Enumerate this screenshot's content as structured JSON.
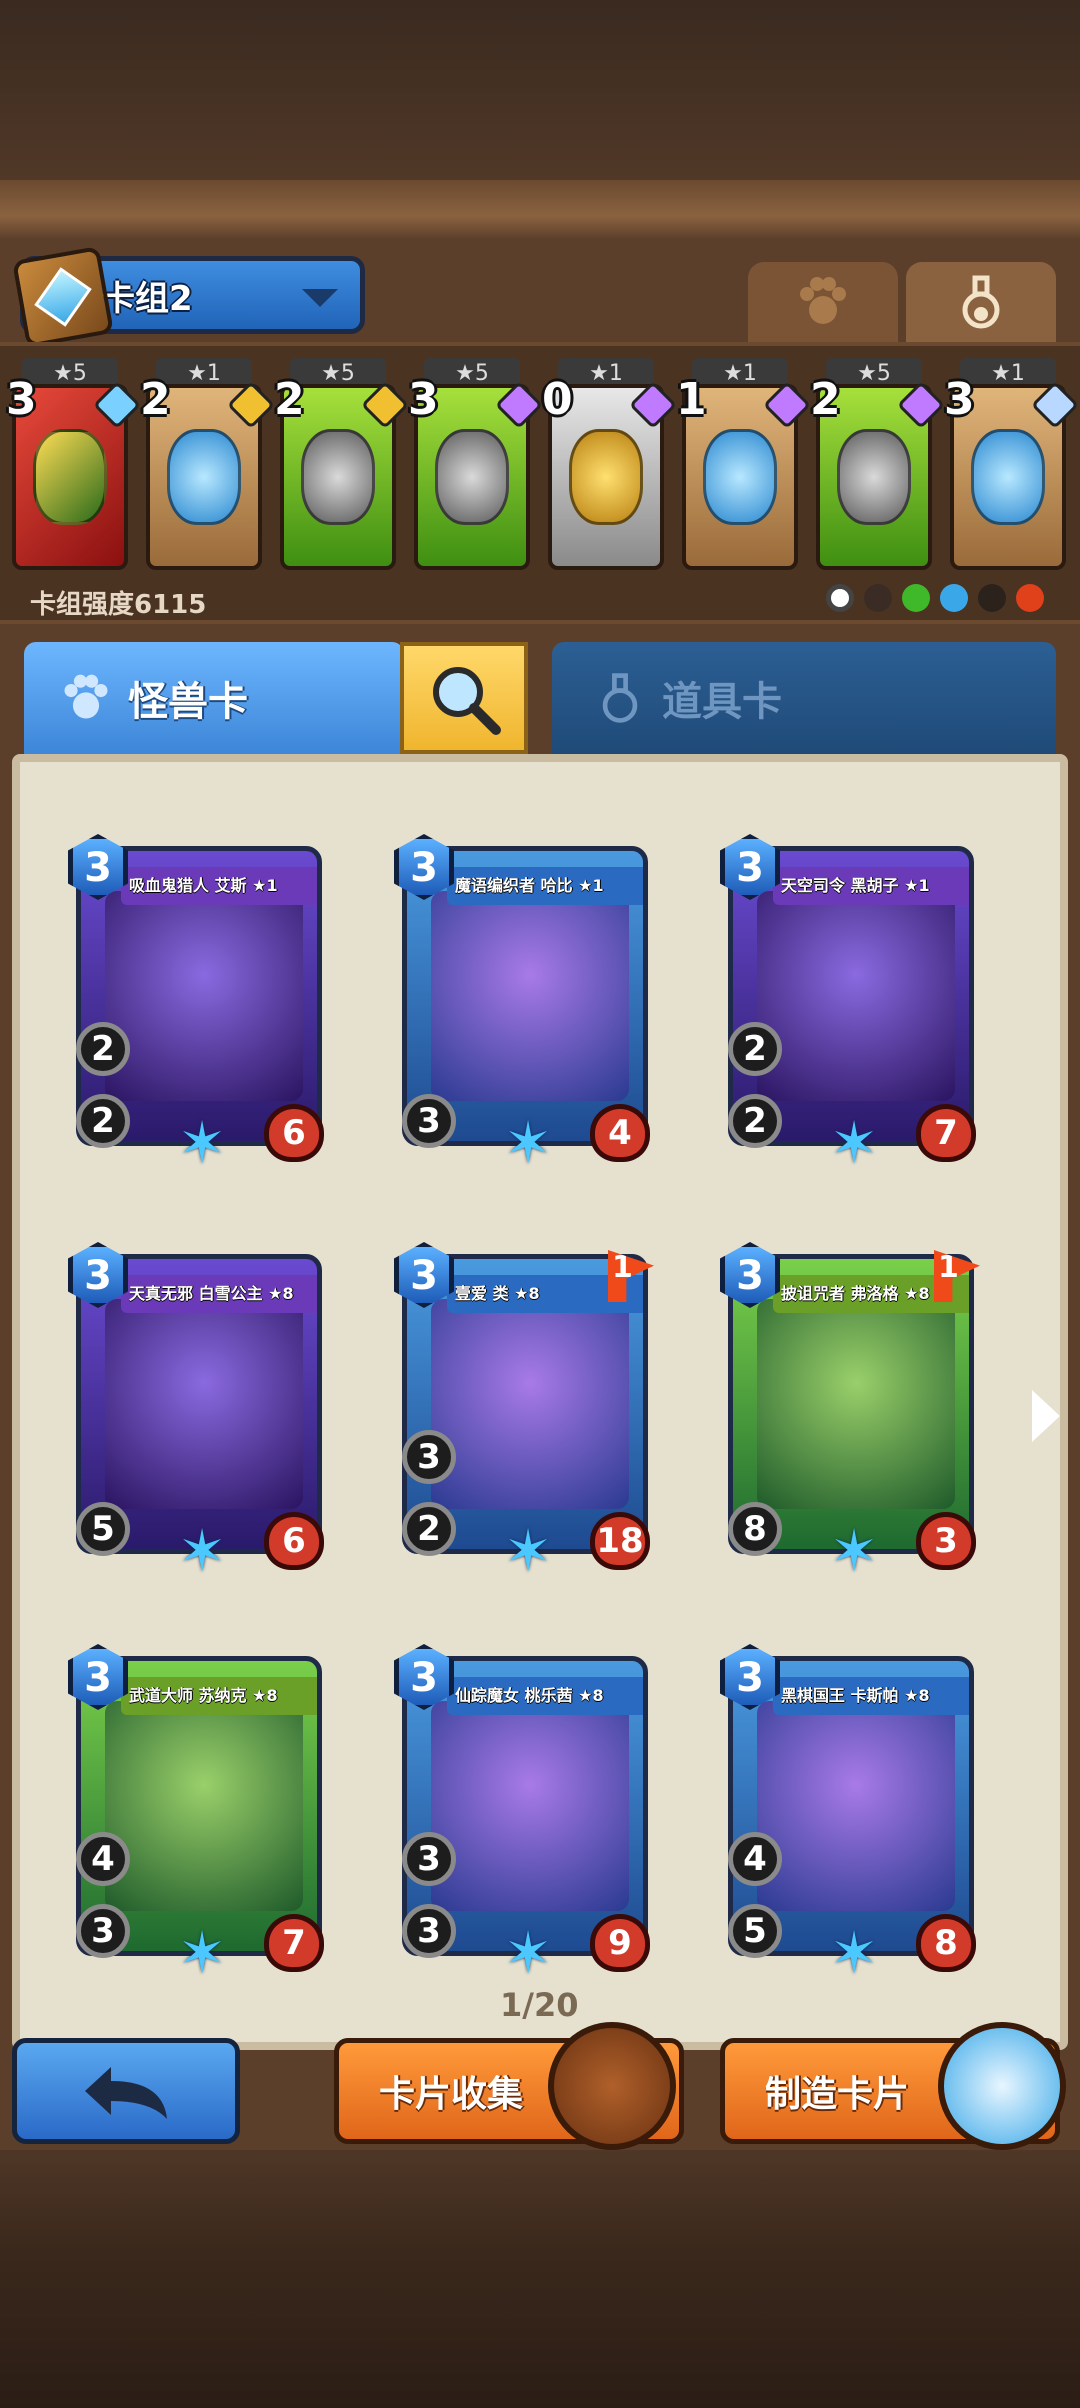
{
  "header": {
    "deck_name": "卡组2",
    "deck_power": "卡组强度6115",
    "tabs": [
      {
        "icon": "paw-icon"
      },
      {
        "icon": "potion-icon"
      }
    ]
  },
  "deck": [
    {
      "count": "3",
      "stars": "★5",
      "frame": "red",
      "gem": "#7ad0ff"
    },
    {
      "count": "2",
      "stars": "★1",
      "frame": "brown",
      "gem": "#f0c030"
    },
    {
      "count": "2",
      "stars": "★5",
      "frame": "green",
      "gem": "#f0c030"
    },
    {
      "count": "3",
      "stars": "★5",
      "frame": "green",
      "gem": "#c07aff"
    },
    {
      "count": "0",
      "stars": "★1",
      "frame": "grey",
      "gem": "#c07aff"
    },
    {
      "count": "1",
      "stars": "★1",
      "frame": "brown",
      "gem": "#c07aff"
    },
    {
      "count": "2",
      "stars": "★5",
      "frame": "green",
      "gem": "#c07aff"
    },
    {
      "count": "3",
      "stars": "★1",
      "frame": "brown",
      "gem": "#b8d8ff"
    }
  ],
  "tabs": {
    "monster": "怪兽卡",
    "item": "道具卡"
  },
  "cards": [
    {
      "name": "吸血鬼猎人 艾斯 ★1",
      "cost": "3",
      "atk_top": "2",
      "atk_bottom": "2",
      "hp": "6",
      "flag": "",
      "theme": "purple"
    },
    {
      "name": "魔语编织者 哈比 ★1",
      "cost": "3",
      "atk_top": "",
      "atk_bottom": "3",
      "hp": "4",
      "flag": "",
      "theme": "blue"
    },
    {
      "name": "天空司令 黑胡子 ★1",
      "cost": "3",
      "atk_top": "2",
      "atk_bottom": "2",
      "hp": "7",
      "flag": "",
      "theme": "purple"
    },
    {
      "name": "天真无邪 白雪公主 ★8",
      "cost": "3",
      "atk_top": "",
      "atk_bottom": "5",
      "hp": "6",
      "flag": "",
      "theme": "purple"
    },
    {
      "name": "壹爱 类 ★8",
      "cost": "3",
      "atk_top": "3",
      "atk_bottom": "2",
      "hp": "18",
      "flag": "1",
      "theme": "blue"
    },
    {
      "name": "披诅咒者 弗洛格 ★8",
      "cost": "3",
      "atk_top": "",
      "atk_bottom": "8",
      "hp": "3",
      "flag": "1",
      "theme": "green"
    },
    {
      "name": "武道大师 苏纳克 ★8",
      "cost": "3",
      "atk_top": "4",
      "atk_bottom": "3",
      "hp": "7",
      "flag": "",
      "theme": "green"
    },
    {
      "name": "仙踪魔女 桃乐茜 ★8",
      "cost": "3",
      "atk_top": "3",
      "atk_bottom": "3",
      "hp": "9",
      "flag": "",
      "theme": "blue"
    },
    {
      "name": "黑棋国王 卡斯帕 ★8",
      "cost": "3",
      "atk_top": "4",
      "atk_bottom": "5",
      "hp": "8",
      "flag": "",
      "theme": "blue"
    }
  ],
  "pagination": "1/20",
  "buttons": {
    "collect": "卡片收集",
    "craft": "制造卡片"
  }
}
